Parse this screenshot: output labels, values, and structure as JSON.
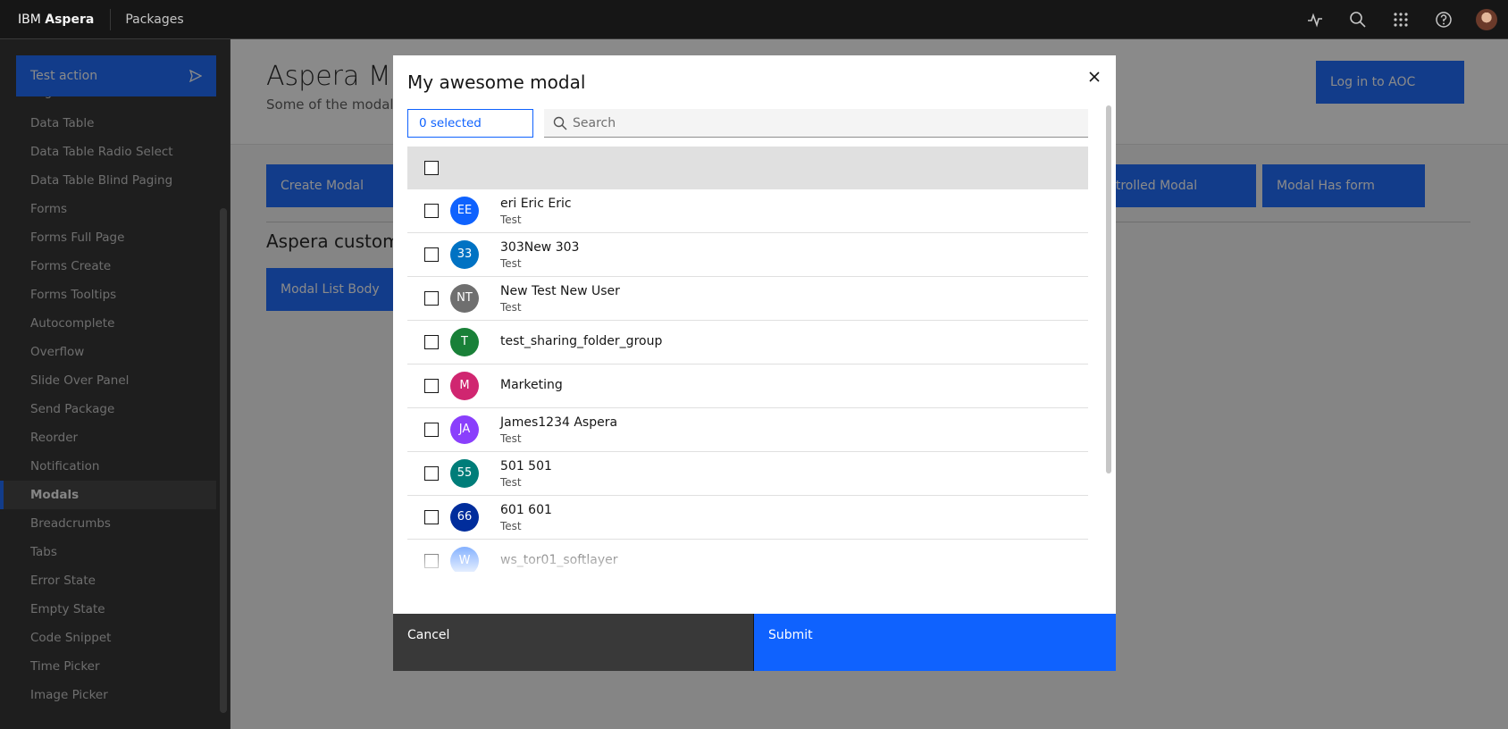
{
  "header": {
    "brand_prefix": "IBM",
    "brand_name": "Aspera",
    "app_name": "Packages"
  },
  "sidebar": {
    "action_label": "Test action",
    "partial_item": "Page Headers",
    "items": [
      "Data Table",
      "Data Table Radio Select",
      "Data Table Blind Paging",
      "Forms",
      "Forms Full Page",
      "Forms Create",
      "Forms Tooltips",
      "Autocomplete",
      "Overflow",
      "Slide Over Panel",
      "Send Package",
      "Reorder",
      "Notification",
      "Modals",
      "Breadcrumbs",
      "Tabs",
      "Error State",
      "Empty State",
      "Code Snippet",
      "Time Picker",
      "Image Picker"
    ],
    "active_item": "Modals"
  },
  "main": {
    "title": "Aspera Mod",
    "subtitle": "Some of the modals",
    "login_button": "Log in to AOC",
    "buttons": {
      "create_modal": "Create Modal",
      "controlled_modal": "ntrolled Modal",
      "modal_has_form": "Modal Has form",
      "modal_list_body": "Modal List Body"
    },
    "section_title": "Aspera custom r"
  },
  "modal": {
    "title": "My awesome modal",
    "selected_count": "0 selected",
    "search_placeholder": "Search",
    "rows": [
      {
        "initials": "EE",
        "name": "eri Eric Eric",
        "sub": "Test",
        "color": "#0f62fe"
      },
      {
        "initials": "33",
        "name": "303New 303",
        "sub": "Test",
        "color": "#0072c3"
      },
      {
        "initials": "NT",
        "name": "New Test New User",
        "sub": "Test",
        "color": "#6f6f6f"
      },
      {
        "initials": "T",
        "name": "test_sharing_folder_group",
        "sub": "",
        "color": "#198038"
      },
      {
        "initials": "M",
        "name": "Marketing",
        "sub": "",
        "color": "#d02670"
      },
      {
        "initials": "JA",
        "name": "James1234 Aspera",
        "sub": "Test",
        "color": "#8a3ffc"
      },
      {
        "initials": "55",
        "name": "501 501",
        "sub": "Test",
        "color": "#007d79"
      },
      {
        "initials": "66",
        "name": "601 601",
        "sub": "Test",
        "color": "#002d9c"
      },
      {
        "initials": "W",
        "name": "ws_tor01_softlayer",
        "sub": "",
        "color": "#4589ff"
      }
    ],
    "cancel_label": "Cancel",
    "submit_label": "Submit"
  },
  "colors": {
    "primary": "#0f62fe",
    "header_bg": "#161616",
    "sidebar_bg": "#262626"
  }
}
